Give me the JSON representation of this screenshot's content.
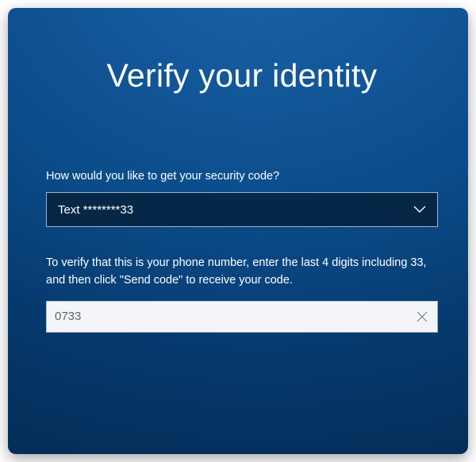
{
  "title": "Verify your identity",
  "prompt_label": "How would you like to get your security code?",
  "method_select": {
    "selected": "Text ********33"
  },
  "instruction_text": "To verify that this is your phone number, enter the last 4 digits including 33, and then click \"Send code\" to receive your code.",
  "phone_input": {
    "value": "0733",
    "placeholder": ""
  },
  "icons": {
    "select_chevron": "chevron-down-icon",
    "input_clear": "close-icon"
  },
  "colors": {
    "background_top": "#1a63a8",
    "background_bottom": "#042a53",
    "select_bg": "#061c32",
    "input_bg": "#f3f5f8",
    "input_fg": "#5a6270"
  }
}
